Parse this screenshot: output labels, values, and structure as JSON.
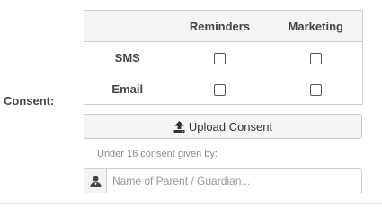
{
  "consent": {
    "label": "Consent:",
    "columns": [
      "Reminders",
      "Marketing"
    ],
    "rows": [
      {
        "label": "SMS",
        "reminders": false,
        "marketing": false
      },
      {
        "label": "Email",
        "reminders": false,
        "marketing": false
      }
    ]
  },
  "upload_button": {
    "label": "Upload Consent",
    "icon": "upload-icon"
  },
  "guardian": {
    "under_label": "Under 16 consent given by:",
    "placeholder": "Name of Parent / Guardian...",
    "value": "",
    "icon": "user-icon"
  }
}
